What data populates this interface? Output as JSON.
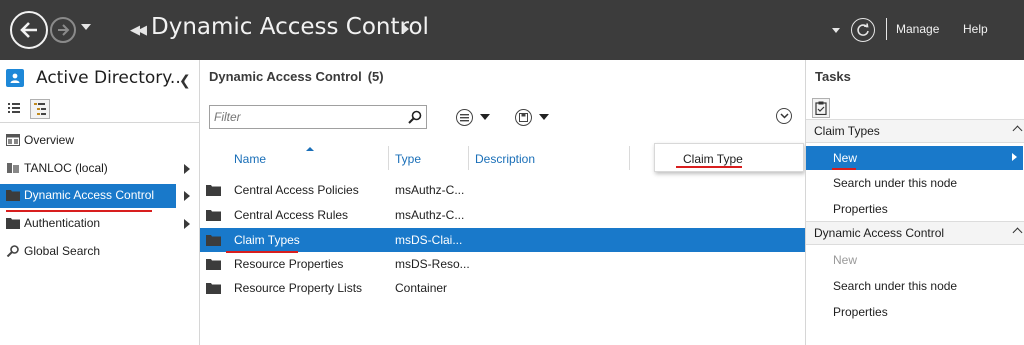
{
  "header": {
    "title": "Dynamic Access Control",
    "manage_label": "Manage",
    "help_label": "Help",
    "back_icon": "back-arrow-icon",
    "forward_icon": "forward-arrow-icon",
    "refresh_icon": "refresh-icon"
  },
  "left_pane": {
    "title": "Active Directory...",
    "items": [
      {
        "label": "Overview",
        "icon": "overview-icon",
        "has_arrow": false
      },
      {
        "label": "TANLOC (local)",
        "icon": "domain-icon",
        "has_arrow": true
      },
      {
        "label": "Dynamic Access Control",
        "icon": "folder-icon",
        "has_arrow": true,
        "selected": true
      },
      {
        "label": "Authentication",
        "icon": "folder-icon",
        "has_arrow": true
      },
      {
        "label": "Global Search",
        "icon": "search-icon",
        "has_arrow": false
      }
    ]
  },
  "center_pane": {
    "title": "Dynamic Access Control",
    "count": "(5)",
    "filter_placeholder": "Filter",
    "columns": [
      "Name",
      "Type",
      "Description"
    ],
    "rows": [
      {
        "name": "Central Access Policies",
        "type": "msAuthz-C..."
      },
      {
        "name": "Central Access Rules",
        "type": "msAuthz-C..."
      },
      {
        "name": "Claim Types",
        "type": "msDS-Clai...",
        "selected": true
      },
      {
        "name": "Resource Properties",
        "type": "msDS-Reso..."
      },
      {
        "name": "Resource Property Lists",
        "type": "Container"
      }
    ],
    "popup_item": "Claim Type"
  },
  "tasks_pane": {
    "title": "Tasks",
    "sections": [
      {
        "header": "Claim Types",
        "items": [
          {
            "label": "New",
            "selected": true
          },
          {
            "label": "Search under this node"
          },
          {
            "label": "Properties"
          }
        ]
      },
      {
        "header": "Dynamic Access Control",
        "items": [
          {
            "label": "New",
            "disabled": true
          },
          {
            "label": "Search under this node"
          },
          {
            "label": "Properties"
          }
        ]
      }
    ]
  },
  "colors": {
    "header_bg": "#3c3c3c",
    "selection_blue": "#1979ca",
    "annotation_red": "#d81e1e",
    "column_header_blue": "#1a6fb8"
  }
}
